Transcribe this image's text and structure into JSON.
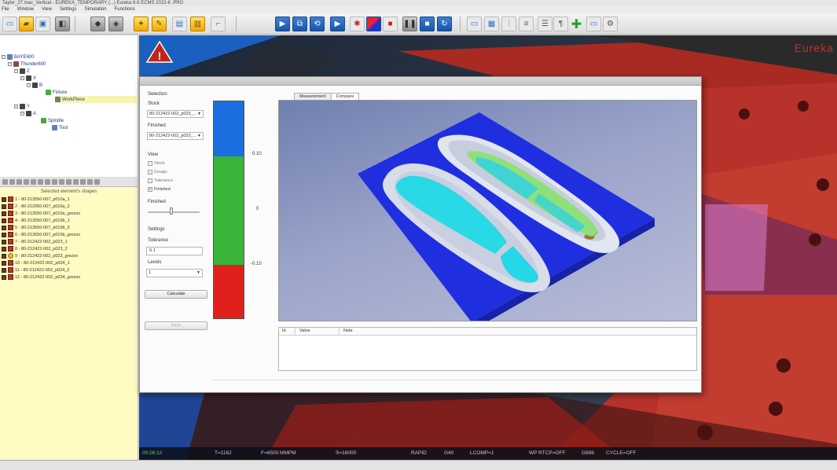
{
  "window": {
    "title": "Taylor_27.mac_Vertical - EUREKA_TEMPORARY (...)  Eureka 6.6  ECMS 2022-6 .PRO"
  },
  "menu": [
    "File",
    "Window",
    "View",
    "Settings",
    "Simulation",
    "Functions"
  ],
  "tree": {
    "items": [
      {
        "label": "BAYE600",
        "depth": 0,
        "icon": "machine-icon"
      },
      {
        "label": "Thunder600",
        "depth": 1,
        "icon": "arm-icon"
      },
      {
        "label": "Z",
        "depth": 2,
        "icon": "axis-icon"
      },
      {
        "label": "X",
        "depth": 3,
        "icon": "axis-icon"
      },
      {
        "label": "B",
        "depth": 4,
        "icon": "axis-icon"
      },
      {
        "label": "Fixture",
        "depth": 5,
        "icon": "fixture-icon"
      },
      {
        "label": "WorkPiece",
        "depth": 6,
        "icon": "workpiece-icon",
        "selected": true
      },
      {
        "label": "Y",
        "depth": 2,
        "icon": "axis-icon"
      },
      {
        "label": "A",
        "depth": 3,
        "icon": "axis-icon"
      },
      {
        "label": "Spindle",
        "depth": 4,
        "icon": "spindle-icon"
      },
      {
        "label": "Tool",
        "depth": 5,
        "icon": "tool-icon"
      }
    ]
  },
  "shapes": {
    "title": "Selected element's shapes",
    "items": [
      {
        "label": "1 - 80-213550-007_p010a_1",
        "color": "#b23a25"
      },
      {
        "label": "2 - 80-212050-007_p010a_2",
        "color": "#b23a25"
      },
      {
        "label": "3 - 80-213550-007_p010a_grezzo",
        "color": "#b23a25"
      },
      {
        "label": "4 - 80-213550-007_p010b_1",
        "color": "#b23a25"
      },
      {
        "label": "5 - 80-213550-007_p010b_2",
        "color": "#b23a25"
      },
      {
        "label": "6 - 80-213550-007_p010b_grezzo",
        "color": "#b23a25"
      },
      {
        "label": "7 - 80-212422-002_p023_1",
        "color": "#b23a25"
      },
      {
        "label": "8 - 80-212422-002_p023_2",
        "color": "#b23a25"
      },
      {
        "label": "9 - 80-212422-002_p023_grezzo",
        "color": "#e6c21a"
      },
      {
        "label": "10 - 80-212422-002_p024_1",
        "color": "#b23a25"
      },
      {
        "label": "11 - 80-212422-002_p024_2",
        "color": "#b23a25"
      },
      {
        "label": "12 - 80-212422-002_p024_grezzo",
        "color": "#b23a25"
      }
    ]
  },
  "dialog": {
    "selection_label": "Selection",
    "stock_label": "Stock",
    "stock_value": "80-212422-002_p023_...",
    "finished_label": "Finished",
    "finished_value": "80-212422-002_p023_...",
    "view_label": "View",
    "checkboxes": [
      {
        "label": "Stock",
        "checked": false
      },
      {
        "label": "Gouge",
        "checked": false
      },
      {
        "label": "Tolerance",
        "checked": false
      },
      {
        "label": "Finished",
        "checked": true
      }
    ],
    "finished_slider_label": "Finished",
    "finished_slider_value": 0.45,
    "settings_label": "Settings",
    "tolerance_label": "Tolerance",
    "tolerance_value": "0.1",
    "levels_label": "Levels",
    "levels_value": "1",
    "calculate_label": "Calculate",
    "save_label": "Save",
    "tabs": [
      "Measurement",
      "Compare"
    ],
    "active_tab": 1,
    "colorbar": {
      "colors": [
        "#1c6fe0",
        "#39b53a",
        "#e0211b"
      ],
      "labels": [
        "0.10",
        "0",
        "-0.10"
      ]
    },
    "table_headers": [
      "Id",
      "Value",
      "Note"
    ]
  },
  "status": {
    "time": "00:26:12",
    "tool": "T=1162",
    "feed": "F=6500 MMPM",
    "speed": "S=16000",
    "mode": "RAPID",
    "gcode": "G40",
    "lcomp": "LCOMP=1",
    "rtcp": "WP RTCP=OFF",
    "g": "G898",
    "cycle": "CYCLE=OFF"
  },
  "logo_text": "Eureka",
  "colors": {
    "accent": "#1a55a8",
    "dialog_bg": "#fbfbfb",
    "shapes_bg": "#fffbc2",
    "viewport_bg": "#2a3340"
  }
}
